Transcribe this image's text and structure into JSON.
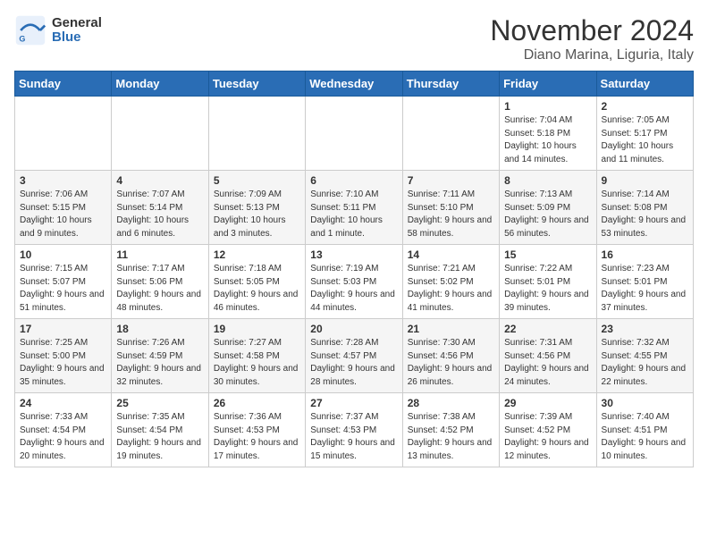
{
  "logo": {
    "general": "General",
    "blue": "Blue"
  },
  "title": "November 2024",
  "location": "Diano Marina, Liguria, Italy",
  "weekdays": [
    "Sunday",
    "Monday",
    "Tuesday",
    "Wednesday",
    "Thursday",
    "Friday",
    "Saturday"
  ],
  "weeks": [
    [
      {
        "day": "",
        "info": ""
      },
      {
        "day": "",
        "info": ""
      },
      {
        "day": "",
        "info": ""
      },
      {
        "day": "",
        "info": ""
      },
      {
        "day": "",
        "info": ""
      },
      {
        "day": "1",
        "info": "Sunrise: 7:04 AM\nSunset: 5:18 PM\nDaylight: 10 hours and 14 minutes."
      },
      {
        "day": "2",
        "info": "Sunrise: 7:05 AM\nSunset: 5:17 PM\nDaylight: 10 hours and 11 minutes."
      }
    ],
    [
      {
        "day": "3",
        "info": "Sunrise: 7:06 AM\nSunset: 5:15 PM\nDaylight: 10 hours and 9 minutes."
      },
      {
        "day": "4",
        "info": "Sunrise: 7:07 AM\nSunset: 5:14 PM\nDaylight: 10 hours and 6 minutes."
      },
      {
        "day": "5",
        "info": "Sunrise: 7:09 AM\nSunset: 5:13 PM\nDaylight: 10 hours and 3 minutes."
      },
      {
        "day": "6",
        "info": "Sunrise: 7:10 AM\nSunset: 5:11 PM\nDaylight: 10 hours and 1 minute."
      },
      {
        "day": "7",
        "info": "Sunrise: 7:11 AM\nSunset: 5:10 PM\nDaylight: 9 hours and 58 minutes."
      },
      {
        "day": "8",
        "info": "Sunrise: 7:13 AM\nSunset: 5:09 PM\nDaylight: 9 hours and 56 minutes."
      },
      {
        "day": "9",
        "info": "Sunrise: 7:14 AM\nSunset: 5:08 PM\nDaylight: 9 hours and 53 minutes."
      }
    ],
    [
      {
        "day": "10",
        "info": "Sunrise: 7:15 AM\nSunset: 5:07 PM\nDaylight: 9 hours and 51 minutes."
      },
      {
        "day": "11",
        "info": "Sunrise: 7:17 AM\nSunset: 5:06 PM\nDaylight: 9 hours and 48 minutes."
      },
      {
        "day": "12",
        "info": "Sunrise: 7:18 AM\nSunset: 5:05 PM\nDaylight: 9 hours and 46 minutes."
      },
      {
        "day": "13",
        "info": "Sunrise: 7:19 AM\nSunset: 5:03 PM\nDaylight: 9 hours and 44 minutes."
      },
      {
        "day": "14",
        "info": "Sunrise: 7:21 AM\nSunset: 5:02 PM\nDaylight: 9 hours and 41 minutes."
      },
      {
        "day": "15",
        "info": "Sunrise: 7:22 AM\nSunset: 5:01 PM\nDaylight: 9 hours and 39 minutes."
      },
      {
        "day": "16",
        "info": "Sunrise: 7:23 AM\nSunset: 5:01 PM\nDaylight: 9 hours and 37 minutes."
      }
    ],
    [
      {
        "day": "17",
        "info": "Sunrise: 7:25 AM\nSunset: 5:00 PM\nDaylight: 9 hours and 35 minutes."
      },
      {
        "day": "18",
        "info": "Sunrise: 7:26 AM\nSunset: 4:59 PM\nDaylight: 9 hours and 32 minutes."
      },
      {
        "day": "19",
        "info": "Sunrise: 7:27 AM\nSunset: 4:58 PM\nDaylight: 9 hours and 30 minutes."
      },
      {
        "day": "20",
        "info": "Sunrise: 7:28 AM\nSunset: 4:57 PM\nDaylight: 9 hours and 28 minutes."
      },
      {
        "day": "21",
        "info": "Sunrise: 7:30 AM\nSunset: 4:56 PM\nDaylight: 9 hours and 26 minutes."
      },
      {
        "day": "22",
        "info": "Sunrise: 7:31 AM\nSunset: 4:56 PM\nDaylight: 9 hours and 24 minutes."
      },
      {
        "day": "23",
        "info": "Sunrise: 7:32 AM\nSunset: 4:55 PM\nDaylight: 9 hours and 22 minutes."
      }
    ],
    [
      {
        "day": "24",
        "info": "Sunrise: 7:33 AM\nSunset: 4:54 PM\nDaylight: 9 hours and 20 minutes."
      },
      {
        "day": "25",
        "info": "Sunrise: 7:35 AM\nSunset: 4:54 PM\nDaylight: 9 hours and 19 minutes."
      },
      {
        "day": "26",
        "info": "Sunrise: 7:36 AM\nSunset: 4:53 PM\nDaylight: 9 hours and 17 minutes."
      },
      {
        "day": "27",
        "info": "Sunrise: 7:37 AM\nSunset: 4:53 PM\nDaylight: 9 hours and 15 minutes."
      },
      {
        "day": "28",
        "info": "Sunrise: 7:38 AM\nSunset: 4:52 PM\nDaylight: 9 hours and 13 minutes."
      },
      {
        "day": "29",
        "info": "Sunrise: 7:39 AM\nSunset: 4:52 PM\nDaylight: 9 hours and 12 minutes."
      },
      {
        "day": "30",
        "info": "Sunrise: 7:40 AM\nSunset: 4:51 PM\nDaylight: 9 hours and 10 minutes."
      }
    ]
  ]
}
